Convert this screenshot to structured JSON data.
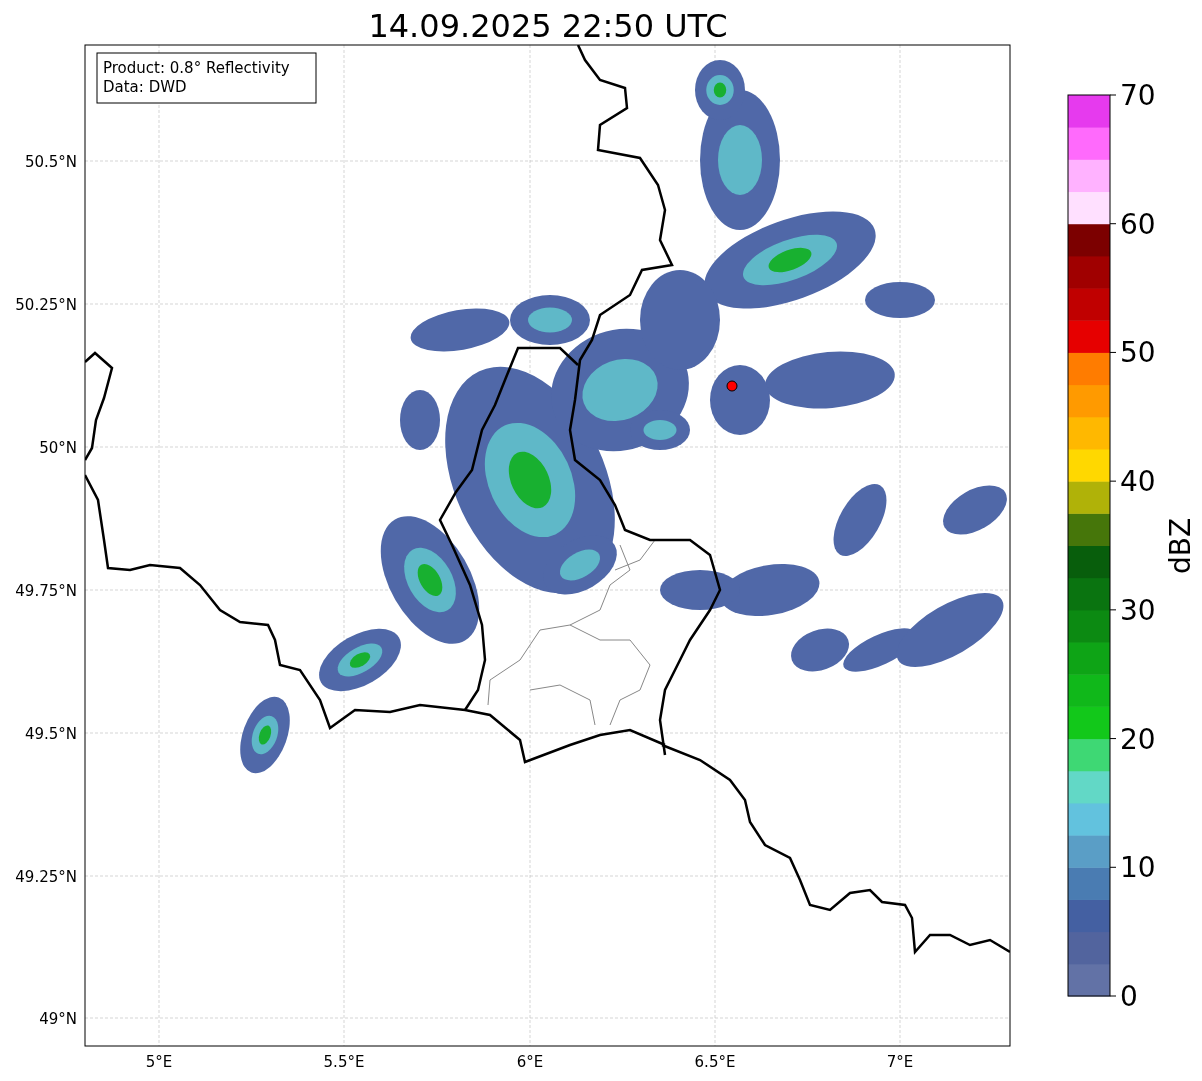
{
  "title": "14.09.2025 22:50 UTC",
  "info_box": [
    "Product: 0.8° Reflectivity",
    "Data: DWD"
  ],
  "map": {
    "x_ticks": [
      "5°E",
      "5.5°E",
      "6°E",
      "6.5°E",
      "7°E"
    ],
    "y_ticks": [
      "50.5°N",
      "50.25°N",
      "50°N",
      "49.75°N",
      "49.5°N",
      "49.25°N",
      "49°N"
    ]
  },
  "colorbar": {
    "label": "dBZ",
    "ticks": [
      "70",
      "60",
      "50",
      "40",
      "30",
      "20",
      "10",
      "0"
    ],
    "segments": [
      {
        "color": "#6272a6"
      },
      {
        "color": "#52649e"
      },
      {
        "color": "#4460a2"
      },
      {
        "color": "#4a7cb2"
      },
      {
        "color": "#5a9ec6"
      },
      {
        "color": "#62c2de"
      },
      {
        "color": "#62d8c6"
      },
      {
        "color": "#3ed874"
      },
      {
        "color": "#12c81a"
      },
      {
        "color": "#10b81a"
      },
      {
        "color": "#0ea416"
      },
      {
        "color": "#0c8a12"
      },
      {
        "color": "#0a7410"
      },
      {
        "color": "#085e0c"
      },
      {
        "color": "#46760a"
      },
      {
        "color": "#b0b208"
      },
      {
        "color": "#ffd800"
      },
      {
        "color": "#ffb800"
      },
      {
        "color": "#ff9a00"
      },
      {
        "color": "#ff7c00"
      },
      {
        "color": "#e60000"
      },
      {
        "color": "#c00000"
      },
      {
        "color": "#a00000"
      },
      {
        "color": "#7c0000"
      },
      {
        "color": "#ffe0ff"
      },
      {
        "color": "#ffb2ff"
      },
      {
        "color": "#ff6afc"
      },
      {
        "color": "#e63aee"
      }
    ]
  }
}
